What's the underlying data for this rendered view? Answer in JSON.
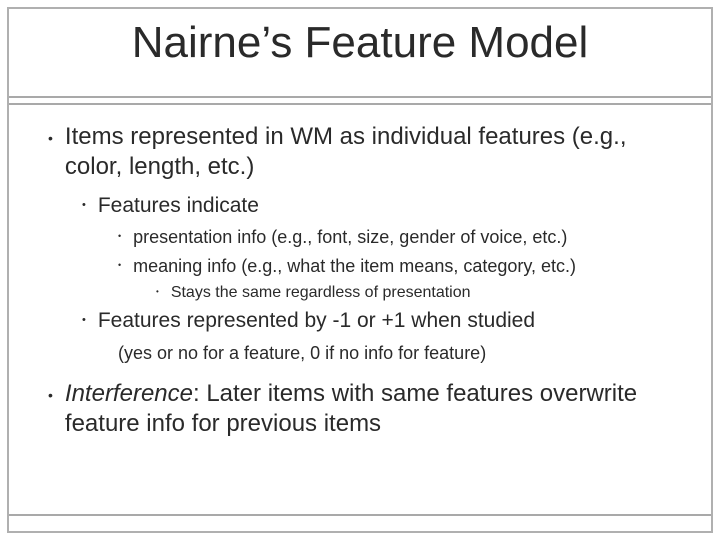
{
  "slide": {
    "title": "Nairne’s Feature Model",
    "bullets": {
      "b1": "Items represented in WM as individual features (e.g., color, length, etc.)",
      "b1a": "Features indicate",
      "b1a_i": "presentation info (e.g., font, size, gender of voice, etc.)",
      "b1a_ii": "meaning info (e.g., what the item means, category, etc.)",
      "b1a_ii_note": "Stays the same regardless of presentation",
      "b1b": "Features represented by -1 or +1 when studied",
      "b1b_sub": "(yes or no for a feature, 0 if no info for feature)",
      "b2_prefix": "Interference",
      "b2_rest": ": Later items with same features overwrite feature info for previous items"
    }
  }
}
